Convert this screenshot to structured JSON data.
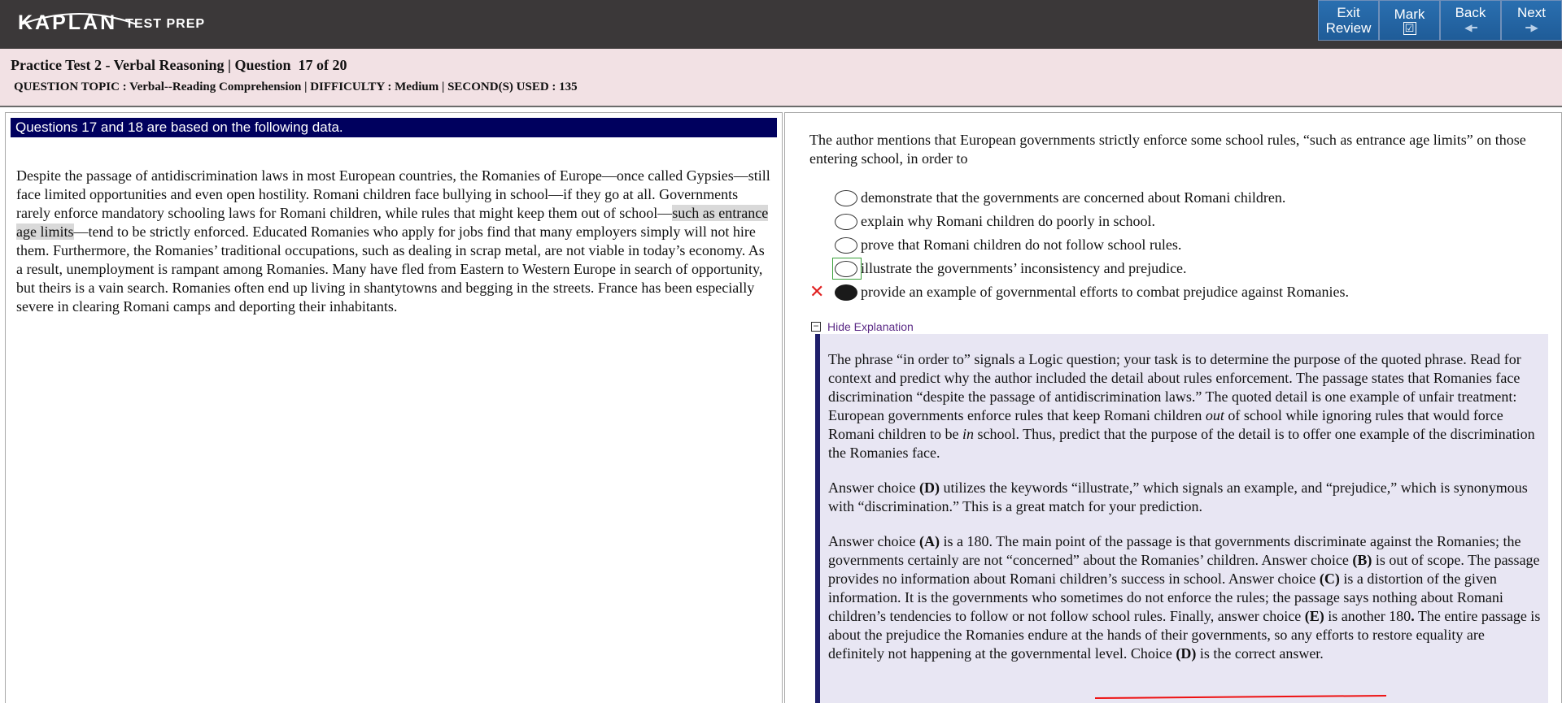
{
  "brand": {
    "logo_text": "KAPLAN",
    "logo_subtext": "TEST PREP"
  },
  "nav": {
    "exit_review": {
      "line1": "Exit",
      "line2": "Review"
    },
    "mark": {
      "label": "Mark",
      "check": "☑"
    },
    "back": {
      "label": "Back"
    },
    "next": {
      "label": "Next"
    }
  },
  "header": {
    "title": "Practice Test 2 - Verbal Reasoning | Question  17 of 20",
    "meta": "QUESTION TOPIC : Verbal--Reading Comprehension | DIFFICULTY : Medium | SECOND(S) USED : 135"
  },
  "passage": {
    "bar": "Questions 17 and 18 are based on the following data.",
    "before": "Despite the passage of antidiscrimination laws in most European countries, the Romanies of Europe—once called Gypsies—still face limited opportunities and even open hostility. Romani children face bullying in school—if they go at all. Governments rarely enforce mandatory schooling laws for Romani children, while rules that might keep them out of school—",
    "highlight": "such as entrance age limits",
    "after": "—tend to be strictly enforced. Educated Romanies who apply for jobs find that many employers simply will not hire them. Furthermore, the Romanies’ traditional occupations, such as dealing in scrap metal, are not viable in today’s economy. As a result, unemployment is rampant among Romanies. Many have fled from Eastern to Western Europe in search of opportunity, but theirs is a vain search. Romanies often end up living in shantytowns and begging in the streets. France has been especially severe in clearing Romani camps and deporting their inhabitants."
  },
  "question": {
    "stem": "The author mentions that European governments strictly enforce some school rules, “such as entrance age limits” on those entering school, in order to",
    "choices": [
      {
        "text": "demonstrate that the governments are concerned about Romani children."
      },
      {
        "text": "explain why Romani children do poorly in school."
      },
      {
        "text": "prove that Romani children do not follow school rules."
      },
      {
        "text": "illustrate the governments’ inconsistency and prejudice."
      },
      {
        "text": "provide an example of governmental efforts to combat prejudice against Romanies."
      }
    ],
    "selected_index": 4,
    "correct_index": 3,
    "wrong_mark": "✕"
  },
  "explanation": {
    "toggle_label": "Hide Explanation",
    "toggle_symbol": "−",
    "p1": "The phrase “in order to” signals a Logic question; your task is to determine the purpose of the quoted phrase. Read for context and predict why the author included the detail about rules enforcement. The passage states that Romanies face discrimination “despite the passage of antidiscrimination laws.” The quoted detail is one example of unfair treatment: European governments enforce rules that keep Romani children",
    "p1_em1": "out",
    "p1_mid": "of school while ignoring rules that would force Romani children to be",
    "p1_em2": "in",
    "p1_end": "school. Thus, predict that the purpose of the detail is to offer one example of the discrimination the Romanies face.",
    "p2_a": "Answer choice",
    "p2_b": "(D)",
    "p2_c": "utilizes the keywords “illustrate,” which signals an example, and “prejudice,” which is synonymous with “discrimination.” This is a great match for your prediction.",
    "p3_a": "Answer choice",
    "p3_b": "(A)",
    "p3_c": "is a 180. The main point of the passage is that governments discriminate against the Romanies; the governments certainly are not “concerned” about the Romanies’ children. Answer choice",
    "p3_d": "(B)",
    "p3_e": "is out of scope. The passage provides no information about Romani children’s success in school. Answer choice",
    "p3_f": "(C)",
    "p3_g": "is a distortion of the given information. It is the governments who sometimes do not enforce the rules; the passage says nothing about Romani children’s tendencies to follow or not follow school rules. Finally, answer choice",
    "p3_h": "(E)",
    "p3_i": "is another 180",
    "p3_j": ".",
    "p3_k": "The entire passage is about the prejudice the Romanies endure at the hands of their governments, so any efforts to restore equality are definitely not happening at the governmental level. Choice",
    "p3_l": "(D)",
    "p3_m": "is the correct answer."
  }
}
